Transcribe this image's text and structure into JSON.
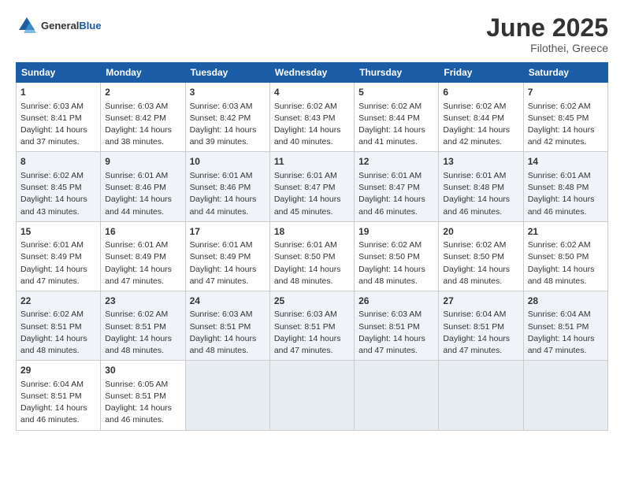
{
  "header": {
    "logo_general": "General",
    "logo_blue": "Blue",
    "month": "June 2025",
    "location": "Filothei, Greece"
  },
  "days_of_week": [
    "Sunday",
    "Monday",
    "Tuesday",
    "Wednesday",
    "Thursday",
    "Friday",
    "Saturday"
  ],
  "weeks": [
    [
      {
        "day": "1",
        "sunrise": "Sunrise: 6:03 AM",
        "sunset": "Sunset: 8:41 PM",
        "daylight": "Daylight: 14 hours and 37 minutes."
      },
      {
        "day": "2",
        "sunrise": "Sunrise: 6:03 AM",
        "sunset": "Sunset: 8:42 PM",
        "daylight": "Daylight: 14 hours and 38 minutes."
      },
      {
        "day": "3",
        "sunrise": "Sunrise: 6:03 AM",
        "sunset": "Sunset: 8:42 PM",
        "daylight": "Daylight: 14 hours and 39 minutes."
      },
      {
        "day": "4",
        "sunrise": "Sunrise: 6:02 AM",
        "sunset": "Sunset: 8:43 PM",
        "daylight": "Daylight: 14 hours and 40 minutes."
      },
      {
        "day": "5",
        "sunrise": "Sunrise: 6:02 AM",
        "sunset": "Sunset: 8:44 PM",
        "daylight": "Daylight: 14 hours and 41 minutes."
      },
      {
        "day": "6",
        "sunrise": "Sunrise: 6:02 AM",
        "sunset": "Sunset: 8:44 PM",
        "daylight": "Daylight: 14 hours and 42 minutes."
      },
      {
        "day": "7",
        "sunrise": "Sunrise: 6:02 AM",
        "sunset": "Sunset: 8:45 PM",
        "daylight": "Daylight: 14 hours and 42 minutes."
      }
    ],
    [
      {
        "day": "8",
        "sunrise": "Sunrise: 6:02 AM",
        "sunset": "Sunset: 8:45 PM",
        "daylight": "Daylight: 14 hours and 43 minutes."
      },
      {
        "day": "9",
        "sunrise": "Sunrise: 6:01 AM",
        "sunset": "Sunset: 8:46 PM",
        "daylight": "Daylight: 14 hours and 44 minutes."
      },
      {
        "day": "10",
        "sunrise": "Sunrise: 6:01 AM",
        "sunset": "Sunset: 8:46 PM",
        "daylight": "Daylight: 14 hours and 44 minutes."
      },
      {
        "day": "11",
        "sunrise": "Sunrise: 6:01 AM",
        "sunset": "Sunset: 8:47 PM",
        "daylight": "Daylight: 14 hours and 45 minutes."
      },
      {
        "day": "12",
        "sunrise": "Sunrise: 6:01 AM",
        "sunset": "Sunset: 8:47 PM",
        "daylight": "Daylight: 14 hours and 46 minutes."
      },
      {
        "day": "13",
        "sunrise": "Sunrise: 6:01 AM",
        "sunset": "Sunset: 8:48 PM",
        "daylight": "Daylight: 14 hours and 46 minutes."
      },
      {
        "day": "14",
        "sunrise": "Sunrise: 6:01 AM",
        "sunset": "Sunset: 8:48 PM",
        "daylight": "Daylight: 14 hours and 46 minutes."
      }
    ],
    [
      {
        "day": "15",
        "sunrise": "Sunrise: 6:01 AM",
        "sunset": "Sunset: 8:49 PM",
        "daylight": "Daylight: 14 hours and 47 minutes."
      },
      {
        "day": "16",
        "sunrise": "Sunrise: 6:01 AM",
        "sunset": "Sunset: 8:49 PM",
        "daylight": "Daylight: 14 hours and 47 minutes."
      },
      {
        "day": "17",
        "sunrise": "Sunrise: 6:01 AM",
        "sunset": "Sunset: 8:49 PM",
        "daylight": "Daylight: 14 hours and 47 minutes."
      },
      {
        "day": "18",
        "sunrise": "Sunrise: 6:01 AM",
        "sunset": "Sunset: 8:50 PM",
        "daylight": "Daylight: 14 hours and 48 minutes."
      },
      {
        "day": "19",
        "sunrise": "Sunrise: 6:02 AM",
        "sunset": "Sunset: 8:50 PM",
        "daylight": "Daylight: 14 hours and 48 minutes."
      },
      {
        "day": "20",
        "sunrise": "Sunrise: 6:02 AM",
        "sunset": "Sunset: 8:50 PM",
        "daylight": "Daylight: 14 hours and 48 minutes."
      },
      {
        "day": "21",
        "sunrise": "Sunrise: 6:02 AM",
        "sunset": "Sunset: 8:50 PM",
        "daylight": "Daylight: 14 hours and 48 minutes."
      }
    ],
    [
      {
        "day": "22",
        "sunrise": "Sunrise: 6:02 AM",
        "sunset": "Sunset: 8:51 PM",
        "daylight": "Daylight: 14 hours and 48 minutes."
      },
      {
        "day": "23",
        "sunrise": "Sunrise: 6:02 AM",
        "sunset": "Sunset: 8:51 PM",
        "daylight": "Daylight: 14 hours and 48 minutes."
      },
      {
        "day": "24",
        "sunrise": "Sunrise: 6:03 AM",
        "sunset": "Sunset: 8:51 PM",
        "daylight": "Daylight: 14 hours and 48 minutes."
      },
      {
        "day": "25",
        "sunrise": "Sunrise: 6:03 AM",
        "sunset": "Sunset: 8:51 PM",
        "daylight": "Daylight: 14 hours and 47 minutes."
      },
      {
        "day": "26",
        "sunrise": "Sunrise: 6:03 AM",
        "sunset": "Sunset: 8:51 PM",
        "daylight": "Daylight: 14 hours and 47 minutes."
      },
      {
        "day": "27",
        "sunrise": "Sunrise: 6:04 AM",
        "sunset": "Sunset: 8:51 PM",
        "daylight": "Daylight: 14 hours and 47 minutes."
      },
      {
        "day": "28",
        "sunrise": "Sunrise: 6:04 AM",
        "sunset": "Sunset: 8:51 PM",
        "daylight": "Daylight: 14 hours and 47 minutes."
      }
    ],
    [
      {
        "day": "29",
        "sunrise": "Sunrise: 6:04 AM",
        "sunset": "Sunset: 8:51 PM",
        "daylight": "Daylight: 14 hours and 46 minutes."
      },
      {
        "day": "30",
        "sunrise": "Sunrise: 6:05 AM",
        "sunset": "Sunset: 8:51 PM",
        "daylight": "Daylight: 14 hours and 46 minutes."
      },
      null,
      null,
      null,
      null,
      null
    ]
  ]
}
